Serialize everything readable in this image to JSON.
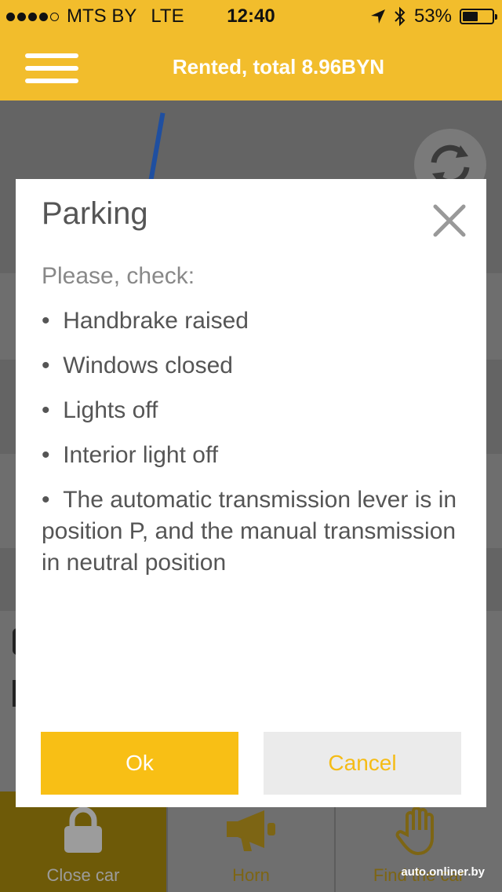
{
  "status_bar": {
    "carrier": "MTS BY",
    "network": "LTE",
    "time": "12:40",
    "battery": "53%",
    "battery_level": 0.53
  },
  "header": {
    "title": "Rented, total 8.96BYN"
  },
  "dialog": {
    "title": "Parking",
    "intro": "Please, check:",
    "items": [
      "Handbrake raised",
      "Windows closed",
      "Lights off",
      "Interior light off",
      "The automatic transmission lever is in position P, and the manual transmission in neutral position"
    ],
    "ok_label": "Ok",
    "cancel_label": "Cancel"
  },
  "bottom_tabs": [
    {
      "label": "Close car",
      "icon": "lock-icon"
    },
    {
      "label": "Horn",
      "icon": "megaphone-icon"
    },
    {
      "label": "Find the car",
      "icon": "hand-icon"
    }
  ],
  "watermark": "auto.onliner.by",
  "colors": {
    "brand_yellow": "#f2bd2c",
    "ok_button": "#f8bf15",
    "cancel_text": "#f5bc16",
    "overlay_gray": "#6b6b6b"
  }
}
